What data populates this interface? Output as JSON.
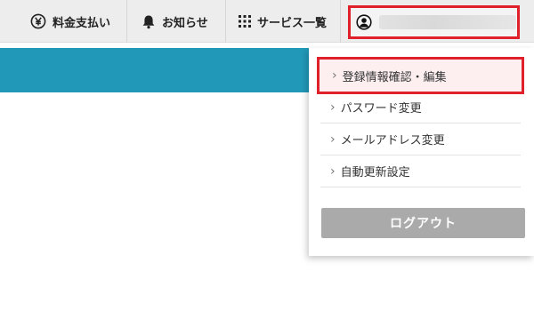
{
  "nav": {
    "payment": {
      "label": "料金支払い",
      "icon": "yen-circle-icon"
    },
    "news": {
      "label": "お知らせ",
      "icon": "bell-icon"
    },
    "services": {
      "label": "サービス一覧",
      "icon": "grid-icon"
    },
    "account": {
      "icon": "user-circle-icon",
      "name": ""
    }
  },
  "menu": {
    "items": [
      {
        "label": "登録情報確認・編集"
      },
      {
        "label": "パスワード変更"
      },
      {
        "label": "メールアドレス変更"
      },
      {
        "label": "自動更新設定"
      }
    ],
    "logout_label": "ログアウト",
    "chevron": "›"
  },
  "colors": {
    "accent_band": "#2298b8",
    "highlight_border": "#e0202a",
    "highlight_fill": "#fdeff0",
    "logout_bg": "#aaaaaa"
  }
}
